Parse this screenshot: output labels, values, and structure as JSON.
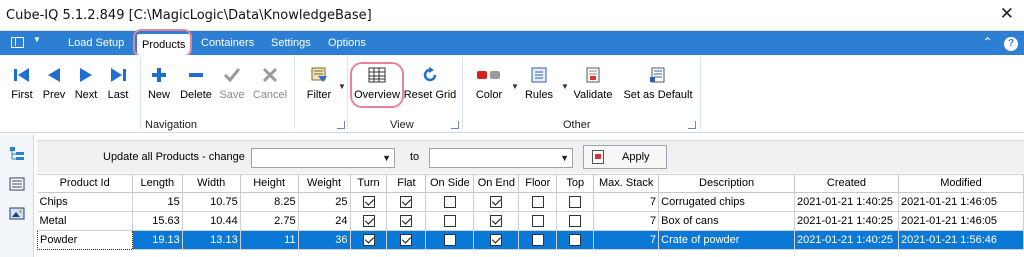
{
  "window": {
    "title": "Cube-IQ  5.1.2.849  [C:\\MagicLogic\\Data\\KnowledgeBase]",
    "close_glyph": "✕"
  },
  "ribbon_tabs": [
    {
      "label": "Load Setup",
      "active": false
    },
    {
      "label": "Products",
      "active": true
    },
    {
      "label": "Containers",
      "active": false
    },
    {
      "label": "Settings",
      "active": false
    },
    {
      "label": "Options",
      "active": false
    }
  ],
  "ribbon_right": {
    "collapse_glyph": "⌃",
    "help_glyph": "?"
  },
  "ribbon": {
    "navigation": {
      "group_label": "Navigation",
      "buttons": [
        {
          "label": "First",
          "icon": "first-icon"
        },
        {
          "label": "Prev",
          "icon": "prev-icon"
        },
        {
          "label": "Next",
          "icon": "next-icon"
        },
        {
          "label": "Last",
          "icon": "last-icon"
        },
        {
          "label": "New",
          "icon": "plus-icon"
        },
        {
          "label": "Delete",
          "icon": "minus-icon"
        },
        {
          "label": "Save",
          "icon": "check-icon",
          "disabled": true
        },
        {
          "label": "Cancel",
          "icon": "x-icon",
          "disabled": true
        }
      ]
    },
    "filter": {
      "label": "Filter"
    },
    "view": {
      "group_label": "View",
      "overview": "Overview",
      "reset_grid": "Reset Grid"
    },
    "other": {
      "group_label": "Other",
      "color": "Color",
      "rules": "Rules",
      "validate": "Validate",
      "set_default": "Set as Default"
    }
  },
  "update_bar": {
    "label": "Update all Products - change",
    "field_value": "",
    "to_label": "to",
    "to_value": "",
    "apply_label": "Apply"
  },
  "grid": {
    "columns": [
      "Product Id",
      "Length",
      "Width",
      "Height",
      "Weight",
      "Turn",
      "Flat",
      "On Side",
      "On End",
      "Floor",
      "Top",
      "Max. Stack",
      "Description",
      "Created",
      "Modified"
    ],
    "rows": [
      {
        "id": "Chips",
        "length": "15",
        "width": "10.75",
        "height": "8.25",
        "weight": "25",
        "turn": true,
        "flat": true,
        "on_side": false,
        "on_end": true,
        "floor": false,
        "top": false,
        "max_stack": "7",
        "description": "Corrugated chips",
        "created": "2021-01-21 1:40:25",
        "modified": "2021-01-21 1:46:05",
        "selected": false
      },
      {
        "id": "Metal",
        "length": "15.63",
        "width": "10.44",
        "height": "2.75",
        "weight": "24",
        "turn": true,
        "flat": true,
        "on_side": false,
        "on_end": true,
        "floor": false,
        "top": false,
        "max_stack": "7",
        "description": "Box of cans",
        "created": "2021-01-21 1:40:25",
        "modified": "2021-01-21 1:46:05",
        "selected": false
      },
      {
        "id": "Powder",
        "length": "19.13",
        "width": "13.13",
        "height": "11",
        "weight": "36",
        "turn": true,
        "flat": true,
        "on_side": false,
        "on_end": true,
        "floor": false,
        "top": false,
        "max_stack": "7",
        "description": "Crate of powder",
        "created": "2021-01-21 1:40:25",
        "modified": "2021-01-21 1:56:46",
        "selected": true
      }
    ]
  },
  "colors": {
    "accent": "#2d7fd3",
    "selection": "#0a78d7",
    "highlight": "#e8849a"
  }
}
